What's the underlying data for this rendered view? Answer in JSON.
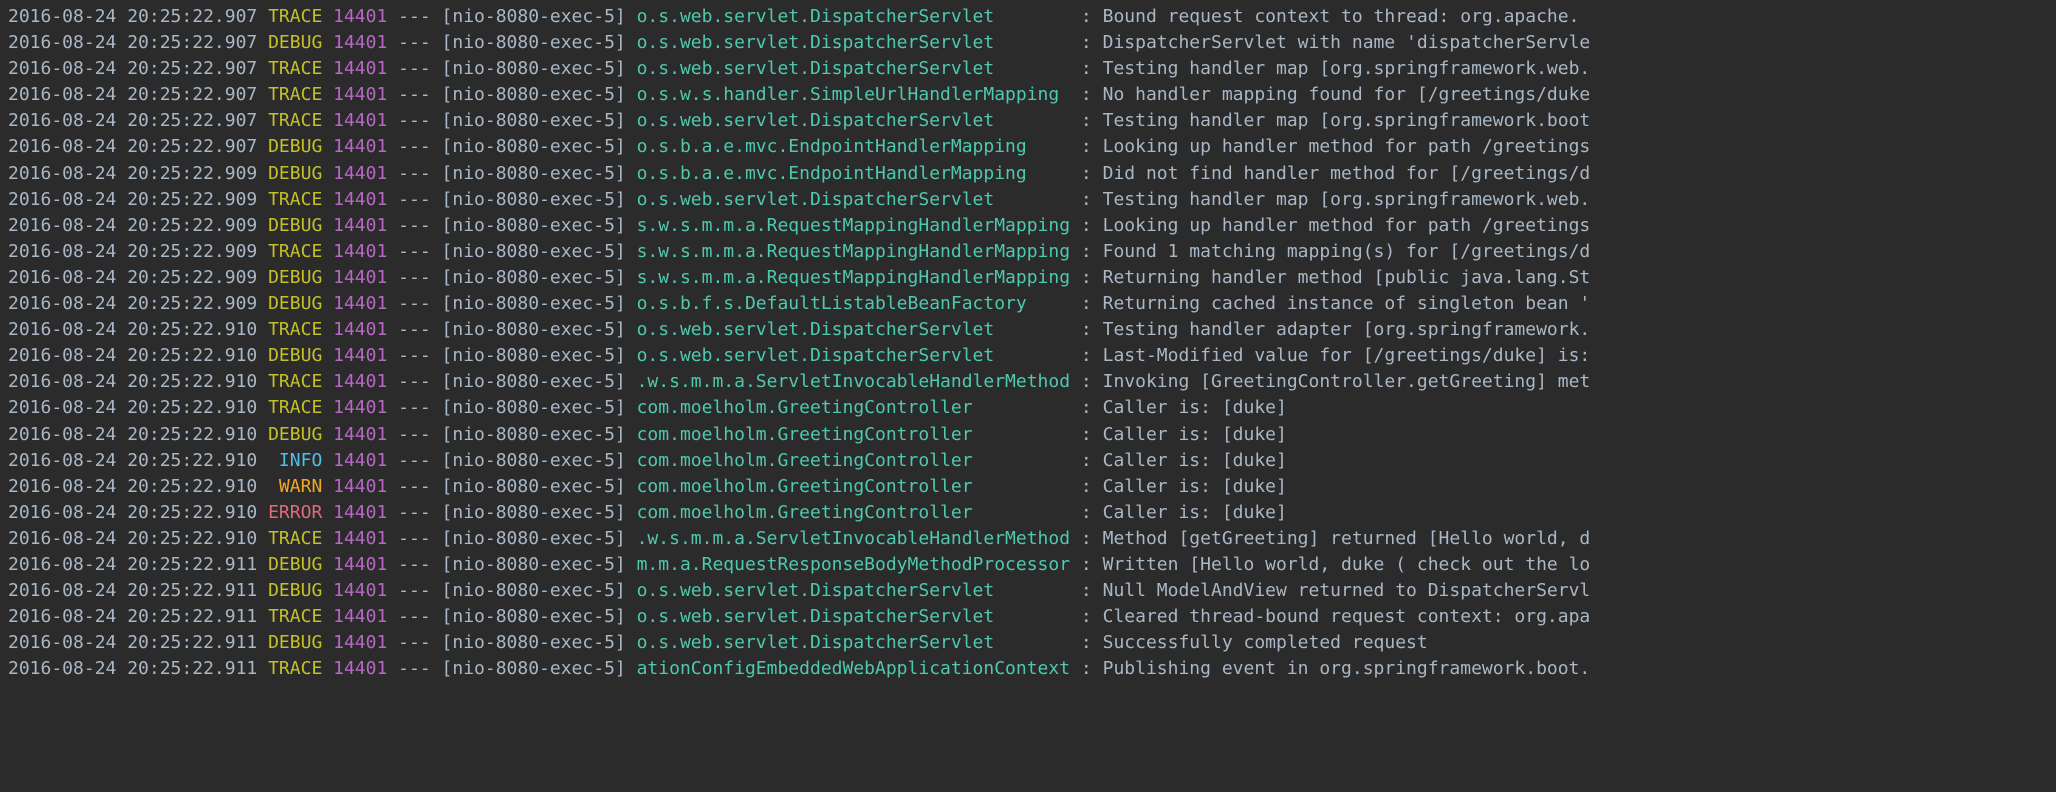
{
  "lines": [
    {
      "timestamp": "2016-08-24 20:25:22.907",
      "level": "TRACE",
      "pid": "14401",
      "dashes": "---",
      "thread": "[nio-8080-exec-5]",
      "logger": "o.s.web.servlet.DispatcherServlet       ",
      "message": "Bound request context to thread: org.apache."
    },
    {
      "timestamp": "2016-08-24 20:25:22.907",
      "level": "DEBUG",
      "pid": "14401",
      "dashes": "---",
      "thread": "[nio-8080-exec-5]",
      "logger": "o.s.web.servlet.DispatcherServlet       ",
      "message": "DispatcherServlet with name 'dispatcherServle"
    },
    {
      "timestamp": "2016-08-24 20:25:22.907",
      "level": "TRACE",
      "pid": "14401",
      "dashes": "---",
      "thread": "[nio-8080-exec-5]",
      "logger": "o.s.web.servlet.DispatcherServlet       ",
      "message": "Testing handler map [org.springframework.web."
    },
    {
      "timestamp": "2016-08-24 20:25:22.907",
      "level": "TRACE",
      "pid": "14401",
      "dashes": "---",
      "thread": "[nio-8080-exec-5]",
      "logger": "o.s.w.s.handler.SimpleUrlHandlerMapping ",
      "message": "No handler mapping found for [/greetings/duke"
    },
    {
      "timestamp": "2016-08-24 20:25:22.907",
      "level": "TRACE",
      "pid": "14401",
      "dashes": "---",
      "thread": "[nio-8080-exec-5]",
      "logger": "o.s.web.servlet.DispatcherServlet       ",
      "message": "Testing handler map [org.springframework.boot"
    },
    {
      "timestamp": "2016-08-24 20:25:22.907",
      "level": "DEBUG",
      "pid": "14401",
      "dashes": "---",
      "thread": "[nio-8080-exec-5]",
      "logger": "o.s.b.a.e.mvc.EndpointHandlerMapping    ",
      "message": "Looking up handler method for path /greetings"
    },
    {
      "timestamp": "2016-08-24 20:25:22.909",
      "level": "DEBUG",
      "pid": "14401",
      "dashes": "---",
      "thread": "[nio-8080-exec-5]",
      "logger": "o.s.b.a.e.mvc.EndpointHandlerMapping    ",
      "message": "Did not find handler method for [/greetings/d"
    },
    {
      "timestamp": "2016-08-24 20:25:22.909",
      "level": "TRACE",
      "pid": "14401",
      "dashes": "---",
      "thread": "[nio-8080-exec-5]",
      "logger": "o.s.web.servlet.DispatcherServlet       ",
      "message": "Testing handler map [org.springframework.web."
    },
    {
      "timestamp": "2016-08-24 20:25:22.909",
      "level": "DEBUG",
      "pid": "14401",
      "dashes": "---",
      "thread": "[nio-8080-exec-5]",
      "logger": "s.w.s.m.m.a.RequestMappingHandlerMapping",
      "message": "Looking up handler method for path /greetings"
    },
    {
      "timestamp": "2016-08-24 20:25:22.909",
      "level": "TRACE",
      "pid": "14401",
      "dashes": "---",
      "thread": "[nio-8080-exec-5]",
      "logger": "s.w.s.m.m.a.RequestMappingHandlerMapping",
      "message": "Found 1 matching mapping(s) for [/greetings/d"
    },
    {
      "timestamp": "2016-08-24 20:25:22.909",
      "level": "DEBUG",
      "pid": "14401",
      "dashes": "---",
      "thread": "[nio-8080-exec-5]",
      "logger": "s.w.s.m.m.a.RequestMappingHandlerMapping",
      "message": "Returning handler method [public java.lang.St"
    },
    {
      "timestamp": "2016-08-24 20:25:22.909",
      "level": "DEBUG",
      "pid": "14401",
      "dashes": "---",
      "thread": "[nio-8080-exec-5]",
      "logger": "o.s.b.f.s.DefaultListableBeanFactory    ",
      "message": "Returning cached instance of singleton bean '"
    },
    {
      "timestamp": "2016-08-24 20:25:22.910",
      "level": "TRACE",
      "pid": "14401",
      "dashes": "---",
      "thread": "[nio-8080-exec-5]",
      "logger": "o.s.web.servlet.DispatcherServlet       ",
      "message": "Testing handler adapter [org.springframework."
    },
    {
      "timestamp": "2016-08-24 20:25:22.910",
      "level": "DEBUG",
      "pid": "14401",
      "dashes": "---",
      "thread": "[nio-8080-exec-5]",
      "logger": "o.s.web.servlet.DispatcherServlet       ",
      "message": "Last-Modified value for [/greetings/duke] is:"
    },
    {
      "timestamp": "2016-08-24 20:25:22.910",
      "level": "TRACE",
      "pid": "14401",
      "dashes": "---",
      "thread": "[nio-8080-exec-5]",
      "logger": ".w.s.m.m.a.ServletInvocableHandlerMethod",
      "message": "Invoking [GreetingController.getGreeting] met"
    },
    {
      "timestamp": "2016-08-24 20:25:22.910",
      "level": "TRACE",
      "pid": "14401",
      "dashes": "---",
      "thread": "[nio-8080-exec-5]",
      "logger": "com.moelholm.GreetingController         ",
      "message": "Caller is: [duke]"
    },
    {
      "timestamp": "2016-08-24 20:25:22.910",
      "level": "DEBUG",
      "pid": "14401",
      "dashes": "---",
      "thread": "[nio-8080-exec-5]",
      "logger": "com.moelholm.GreetingController         ",
      "message": "Caller is: [duke]"
    },
    {
      "timestamp": "2016-08-24 20:25:22.910",
      "level": " INFO",
      "pid": "14401",
      "dashes": "---",
      "thread": "[nio-8080-exec-5]",
      "logger": "com.moelholm.GreetingController         ",
      "message": "Caller is: [duke]"
    },
    {
      "timestamp": "2016-08-24 20:25:22.910",
      "level": " WARN",
      "pid": "14401",
      "dashes": "---",
      "thread": "[nio-8080-exec-5]",
      "logger": "com.moelholm.GreetingController         ",
      "message": "Caller is: [duke]"
    },
    {
      "timestamp": "2016-08-24 20:25:22.910",
      "level": "ERROR",
      "pid": "14401",
      "dashes": "---",
      "thread": "[nio-8080-exec-5]",
      "logger": "com.moelholm.GreetingController         ",
      "message": "Caller is: [duke]"
    },
    {
      "timestamp": "2016-08-24 20:25:22.910",
      "level": "TRACE",
      "pid": "14401",
      "dashes": "---",
      "thread": "[nio-8080-exec-5]",
      "logger": ".w.s.m.m.a.ServletInvocableHandlerMethod",
      "message": "Method [getGreeting] returned [Hello world, d"
    },
    {
      "timestamp": "2016-08-24 20:25:22.911",
      "level": "DEBUG",
      "pid": "14401",
      "dashes": "---",
      "thread": "[nio-8080-exec-5]",
      "logger": "m.m.a.RequestResponseBodyMethodProcessor",
      "message": "Written [Hello world, duke ( check out the lo"
    },
    {
      "timestamp": "2016-08-24 20:25:22.911",
      "level": "DEBUG",
      "pid": "14401",
      "dashes": "---",
      "thread": "[nio-8080-exec-5]",
      "logger": "o.s.web.servlet.DispatcherServlet       ",
      "message": "Null ModelAndView returned to DispatcherServl"
    },
    {
      "timestamp": "2016-08-24 20:25:22.911",
      "level": "TRACE",
      "pid": "14401",
      "dashes": "---",
      "thread": "[nio-8080-exec-5]",
      "logger": "o.s.web.servlet.DispatcherServlet       ",
      "message": "Cleared thread-bound request context: org.apa"
    },
    {
      "timestamp": "2016-08-24 20:25:22.911",
      "level": "DEBUG",
      "pid": "14401",
      "dashes": "---",
      "thread": "[nio-8080-exec-5]",
      "logger": "o.s.web.servlet.DispatcherServlet       ",
      "message": "Successfully completed request"
    },
    {
      "timestamp": "2016-08-24 20:25:22.911",
      "level": "TRACE",
      "pid": "14401",
      "dashes": "---",
      "thread": "[nio-8080-exec-5]",
      "logger": "ationConfigEmbeddedWebApplicationContext",
      "message": "Publishing event in org.springframework.boot."
    }
  ]
}
